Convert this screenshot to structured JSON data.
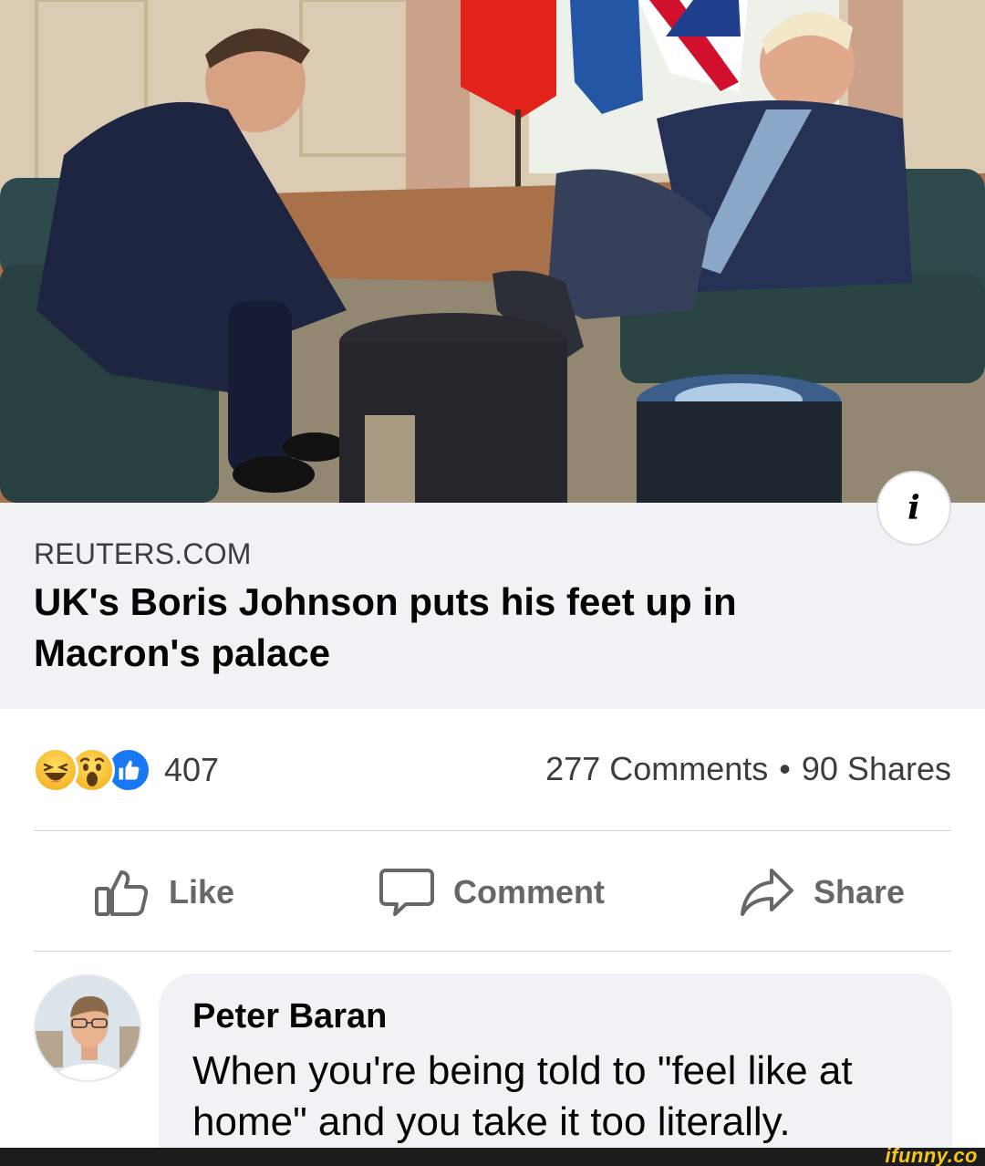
{
  "post": {
    "image_alt": "",
    "link_domain": "REUTERS.COM",
    "link_title": "UK's Boris Johnson puts his feet up in Macron's palace",
    "info_icon": "i"
  },
  "engagement": {
    "reaction_icons": [
      "haha-icon",
      "wow-icon",
      "like-icon"
    ],
    "reaction_count": "407",
    "comments": "277 Comments",
    "separator": "•",
    "shares": "90 Shares"
  },
  "actions": {
    "like_label": "Like",
    "comment_label": "Comment",
    "share_label": "Share"
  },
  "comment": {
    "author": "Peter Baran",
    "text": "When you're being told to \"feel like at home\" and you take it too literally."
  },
  "watermark": "ifunny.co",
  "colors": {
    "card_bg": "#f0f2f5",
    "text_primary": "#050505",
    "text_secondary": "#65676b",
    "like_blue": "#1877f2",
    "reaction_yellow": "#f7b125",
    "watermark_yellow": "#f5c518"
  }
}
